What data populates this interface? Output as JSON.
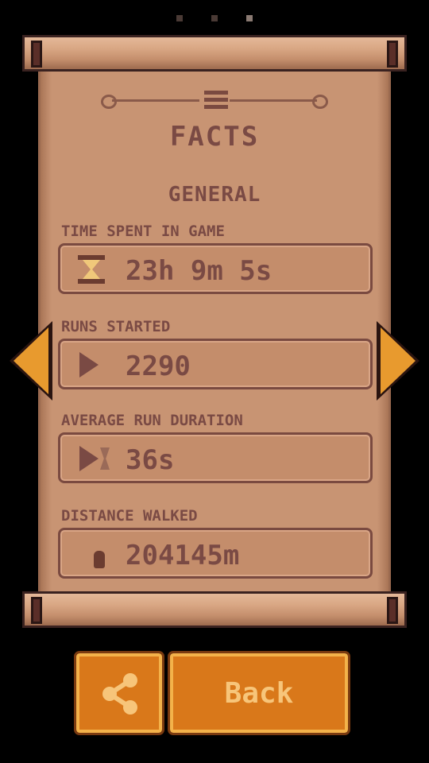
{
  "pagination": {
    "pages": 3,
    "active_index": 2
  },
  "panel": {
    "title": "FACTS",
    "section": "GENERAL",
    "stats": [
      {
        "label": "TIME SPENT IN GAME",
        "value": "23h 9m 5s",
        "icon": "hourglass-icon"
      },
      {
        "label": "RUNS STARTED",
        "value": "2290",
        "icon": "play-icon"
      },
      {
        "label": "AVERAGE RUN DURATION",
        "value": "36s",
        "icon": "play-hourglass-icon"
      },
      {
        "label": "DISTANCE WALKED",
        "value": "204145m",
        "icon": "footprint-icon"
      }
    ]
  },
  "buttons": {
    "share_icon": "share-icon",
    "back_label": "Back"
  },
  "colors": {
    "accent": "#d9781a",
    "parchment": "#c89473",
    "ink": "#7a4a44"
  }
}
